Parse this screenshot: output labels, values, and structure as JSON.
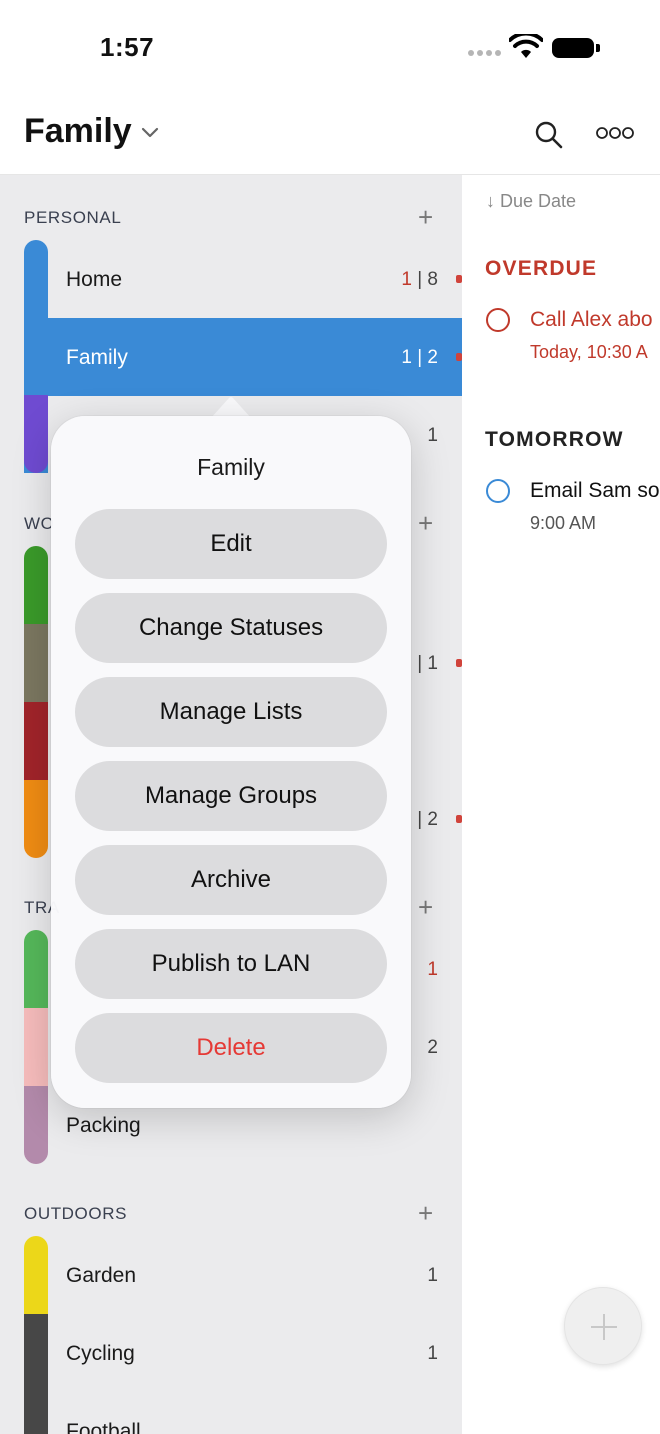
{
  "status_bar": {
    "time": "1:57"
  },
  "header": {
    "title": "Family"
  },
  "sidebar": {
    "sections": [
      {
        "name": "PERSONAL"
      },
      {
        "name": "WO"
      },
      {
        "name": "TRA"
      },
      {
        "name": "OUTDOORS"
      }
    ],
    "personal_rows": [
      {
        "label": "Home",
        "count_overdue": "1",
        "count_sep": " | ",
        "count_total": "8",
        "color": "#3a8ad6"
      },
      {
        "label": "Family",
        "count_overdue": "1",
        "count_sep": " | ",
        "count_total": "2",
        "color": "#3a8ad6"
      },
      {
        "label": "",
        "count_total": "1",
        "color": "#6f4bd1"
      }
    ],
    "work_rows": [
      {
        "color": "#3a9a2a"
      },
      {
        "count_total": "| 1",
        "color": "#7b7760"
      },
      {
        "color": "#a1242a"
      },
      {
        "count_total": "| 2",
        "color": "#f08c13"
      }
    ],
    "travel_rows": [
      {
        "count_overdue": "1",
        "color": "#55b85a"
      },
      {
        "count_total": "2",
        "color": "#f6bcbc"
      },
      {
        "label": "Packing",
        "color": "#b38aab"
      }
    ],
    "outdoor_rows": [
      {
        "label": "Garden",
        "count_total": "1",
        "color": "#ecd719"
      },
      {
        "label": "Cycling",
        "count_total": "1",
        "color": "#474747"
      },
      {
        "label": "Football",
        "color": "#474747"
      }
    ]
  },
  "task_panel": {
    "sort_label": "↓ Due Date",
    "groups": [
      {
        "title": "OVERDUE",
        "color": "#c0392b",
        "task": {
          "title": "Call Alex abo",
          "sub": "Today, 10:30 A"
        }
      },
      {
        "title": "TOMORROW",
        "color": "#222222",
        "task": {
          "title": "Email Sam so",
          "sub": "9:00 AM"
        }
      }
    ]
  },
  "popover": {
    "title": "Family",
    "items": [
      {
        "label": "Edit"
      },
      {
        "label": "Change Statuses"
      },
      {
        "label": "Manage Lists"
      },
      {
        "label": "Manage Groups"
      },
      {
        "label": "Archive"
      },
      {
        "label": "Publish to LAN"
      },
      {
        "label": "Delete",
        "destructive": true
      }
    ]
  },
  "colors": {
    "accent": "#3a8ad6",
    "danger": "#e53935",
    "overdue": "#c0392b"
  }
}
